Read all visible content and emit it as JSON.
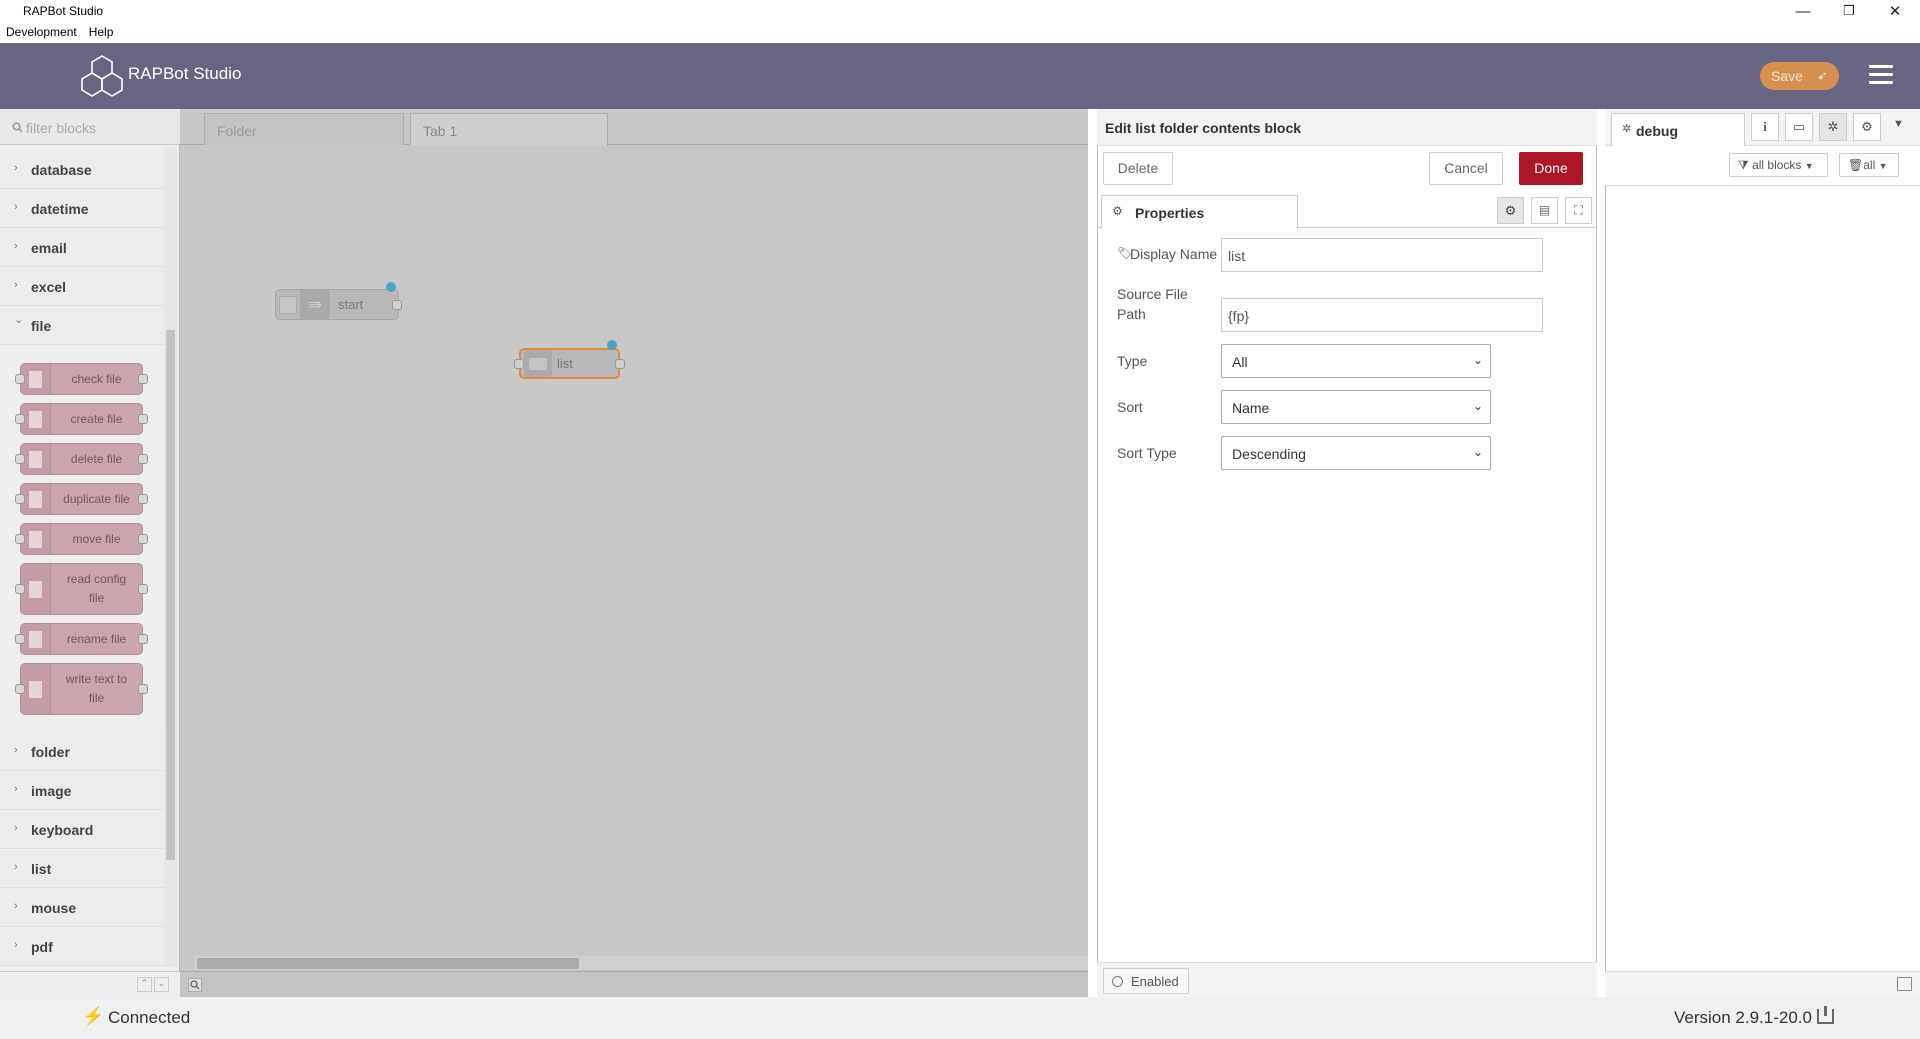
{
  "window": {
    "title": "RAPBot Studio",
    "minimize": "—",
    "restore": "❐",
    "close": "✕"
  },
  "menubar": [
    "Development",
    "Help"
  ],
  "header": {
    "app_name": "RAPBot Studio",
    "save_label": "Save"
  },
  "palette": {
    "filter_placeholder": "filter blocks",
    "categories_top": [
      {
        "label": "database",
        "chevron": "›"
      },
      {
        "label": "datetime",
        "chevron": "›"
      },
      {
        "label": "email",
        "chevron": "›"
      },
      {
        "label": "excel",
        "chevron": "›"
      },
      {
        "label": "file",
        "chevron": "⌄"
      }
    ],
    "file_nodes": [
      {
        "label": "check file"
      },
      {
        "label": "create file"
      },
      {
        "label": "delete file"
      },
      {
        "label": "duplicate file"
      },
      {
        "label": "move file"
      },
      {
        "label": "read config file"
      },
      {
        "label": "rename file"
      },
      {
        "label": "write text to file"
      }
    ],
    "categories_bottom": [
      {
        "label": "folder",
        "chevron": "›"
      },
      {
        "label": "image",
        "chevron": "›"
      },
      {
        "label": "keyboard",
        "chevron": "›"
      },
      {
        "label": "list",
        "chevron": "›"
      },
      {
        "label": "mouse",
        "chevron": "›"
      },
      {
        "label": "pdf",
        "chevron": "›"
      }
    ]
  },
  "workspace": {
    "tabs": [
      {
        "label": "Folder"
      },
      {
        "label": "Tab 1"
      }
    ],
    "nodes": [
      {
        "label": "start"
      },
      {
        "label": "list"
      }
    ]
  },
  "editor": {
    "title": "Edit list folder contents block",
    "delete_label": "Delete",
    "cancel_label": "Cancel",
    "done_label": "Done",
    "properties_tab": "Properties",
    "display_name_label": "Display Name",
    "display_name_value": "list",
    "source_path_label_1": "Source File",
    "source_path_label_2": "Path",
    "source_path_value": "{fp}",
    "type_label": "Type",
    "type_value": "All",
    "sort_label": "Sort",
    "sort_value": "Name",
    "sort_type_label": "Sort Type",
    "sort_type_value": "Descending",
    "enabled_label": "Enabled"
  },
  "sidebar": {
    "tab_label": "debug",
    "filter_label": "all blocks",
    "clear_label": "all"
  },
  "status": {
    "connection": "Connected",
    "version": "Version 2.9.1-20.0"
  },
  "colors": {
    "header": "#686582",
    "save": "#d6904f",
    "done": "#ad1625",
    "node_file": "#c9a5ae",
    "port_selected": "#4aa3c5"
  }
}
